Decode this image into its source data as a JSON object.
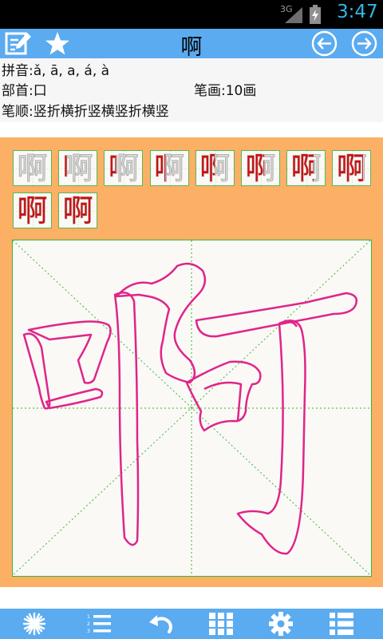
{
  "status_bar": {
    "network": "3G",
    "time": "3:47"
  },
  "title_bar": {
    "title": "啊",
    "icons": [
      "edit-icon",
      "star-icon",
      "arrow-left-icon",
      "arrow-right-icon"
    ]
  },
  "info": {
    "pinyin_label": "拼音:",
    "pinyin_value": "ǎ, ā, a, á, à",
    "radical_label": "部首:",
    "radical_value": "口",
    "strokes_label": "笔画:",
    "strokes_value": "10画",
    "order_label": "笔顺:",
    "order_value": "竖折横折竖横竖折横竖"
  },
  "stroke_thumbnails": {
    "character": "啊",
    "count": 10
  },
  "canvas": {
    "character": "啊",
    "stroke_color": "#e0248a",
    "guide_color": "#3cb43c"
  },
  "bottom_bar": {
    "icons": [
      "starburst-icon",
      "numbered-list-icon",
      "undo-icon",
      "grid-icon",
      "settings-icon",
      "list-icon"
    ]
  },
  "colors": {
    "title_bar": "#5aabf0",
    "panel_background": "#fbb065",
    "thumb_border": "#58b758",
    "stroke_highlight": "#cc1010"
  }
}
